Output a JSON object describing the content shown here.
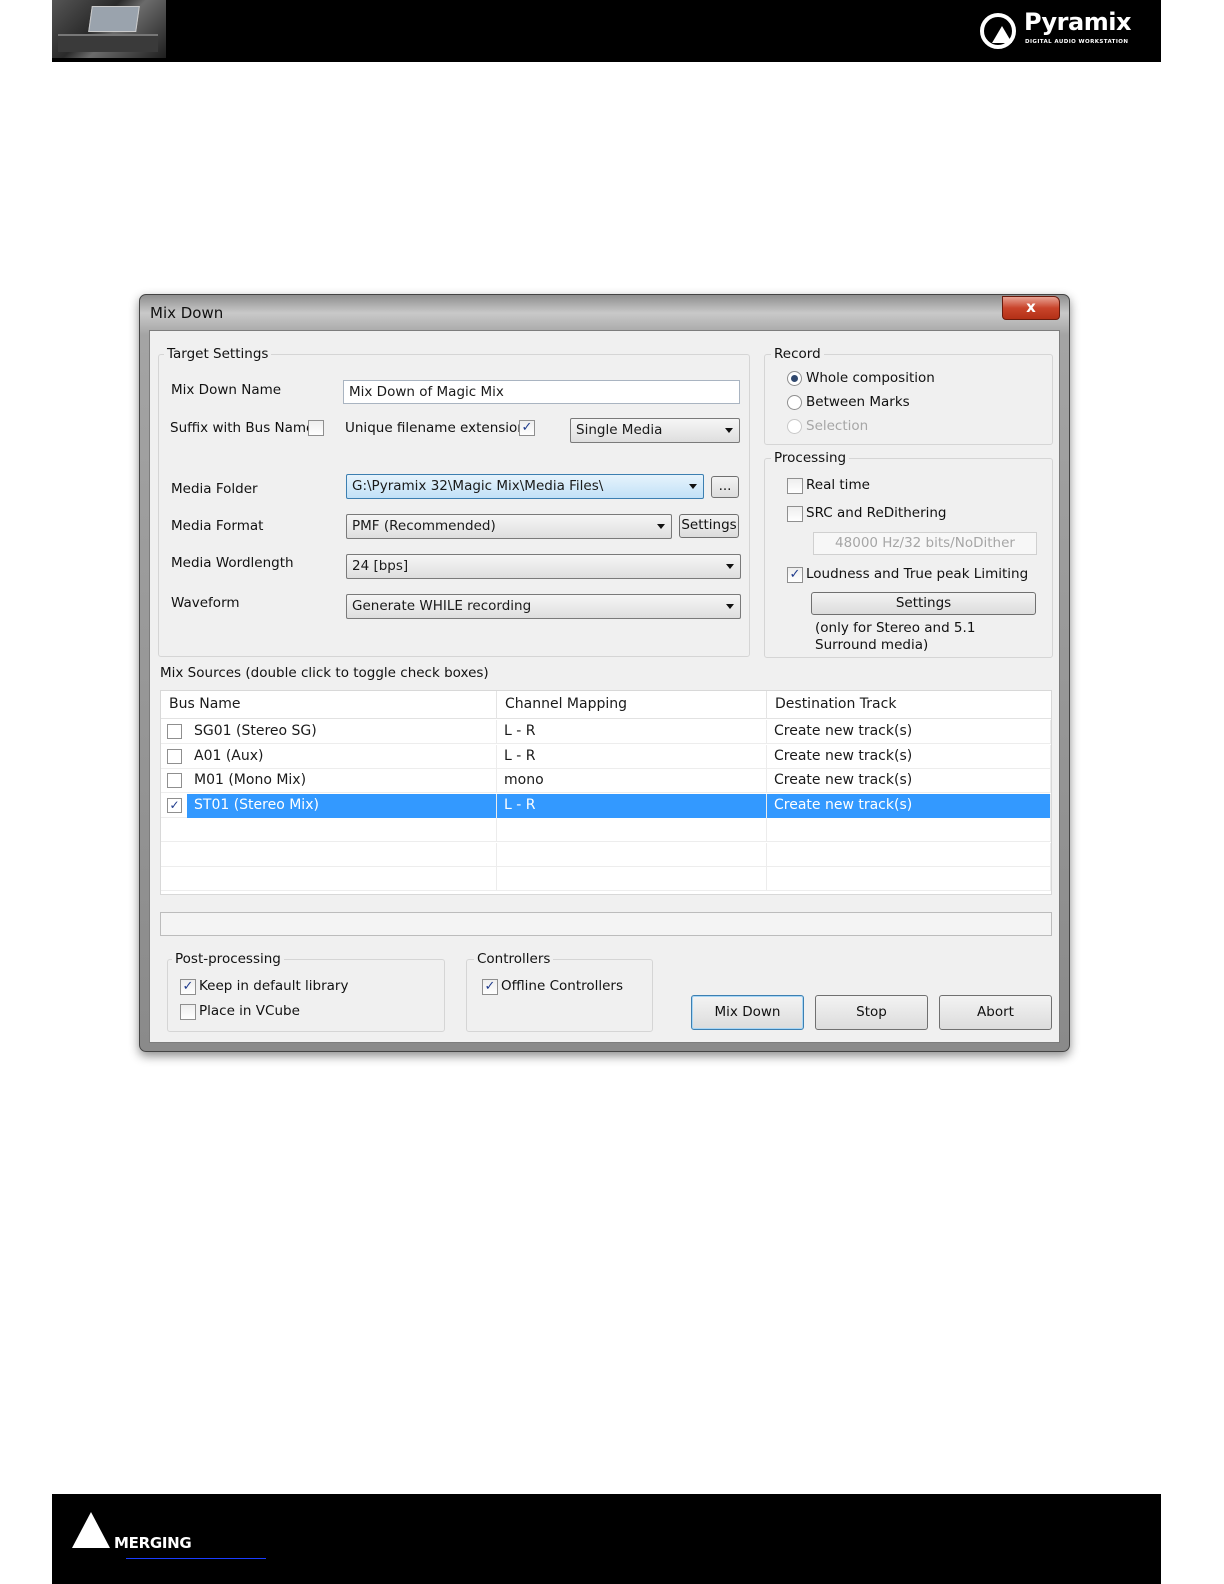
{
  "brand": {
    "product": "Pyramix",
    "product_tagline": "DIGITAL AUDIO WORKSTATION",
    "company": "MERGING"
  },
  "window": {
    "title": "Mix Down",
    "close_label": "x"
  },
  "target_settings": {
    "title": "Target Settings",
    "mixdown_name_label": "Mix Down Name",
    "mixdown_name_value": "Mix Down of Magic Mix",
    "suffix_label": "Suffix with Bus Name",
    "suffix_checked": false,
    "unique_label": "Unique filename extension",
    "unique_checked": true,
    "media_mode_value": "Single Media",
    "media_folder_label": "Media Folder",
    "media_folder_value": "G:\\Pyramix 32\\Magic Mix\\Media Files\\",
    "browse_label": "...",
    "media_format_label": "Media Format",
    "media_format_value": "PMF (Recommended)",
    "settings_label": "Settings",
    "wordlength_label": "Media Wordlength",
    "wordlength_value": "24 [bps]",
    "waveform_label": "Waveform",
    "waveform_value": "Generate WHILE recording"
  },
  "record": {
    "title": "Record",
    "options": [
      "Whole composition",
      "Between Marks",
      "Selection"
    ],
    "selected": "Whole composition"
  },
  "processing": {
    "title": "Processing",
    "realtime_label": "Real time",
    "realtime_checked": false,
    "src_label": "SRC and ReDithering",
    "src_checked": false,
    "src_value": "48000 Hz/32 bits/NoDither",
    "loudness_label": "Loudness and True peak Limiting",
    "loudness_checked": true,
    "settings_label": "Settings",
    "note": "(only for Stereo and 5.1 Surround media)"
  },
  "sources": {
    "title": "Mix Sources (double click to toggle check boxes)",
    "columns": [
      "Bus Name",
      "Channel Mapping",
      "Destination Track"
    ],
    "rows": [
      {
        "bus": "SG01 (Stereo SG)",
        "mapping": "L - R",
        "dest": "Create new track(s)",
        "checked": false,
        "selected": false
      },
      {
        "bus": "A01 (Aux)",
        "mapping": "L - R",
        "dest": "Create new track(s)",
        "checked": false,
        "selected": false
      },
      {
        "bus": "M01 (Mono Mix)",
        "mapping": "mono",
        "dest": "Create new track(s)",
        "checked": false,
        "selected": false
      },
      {
        "bus": "ST01 (Stereo Mix)",
        "mapping": "L - R",
        "dest": "Create new track(s)",
        "checked": true,
        "selected": true
      }
    ]
  },
  "post_processing": {
    "title": "Post-processing",
    "keep_label": "Keep in default library",
    "keep_checked": true,
    "vcube_label": "Place in VCube",
    "vcube_checked": false
  },
  "controllers": {
    "title": "Controllers",
    "offline_label": "Offline Controllers",
    "offline_checked": true
  },
  "actions": {
    "mixdown": "Mix Down",
    "stop": "Stop",
    "abort": "Abort"
  },
  "colors": {
    "selection": "#3399ff",
    "close_button": "#c9442b"
  }
}
